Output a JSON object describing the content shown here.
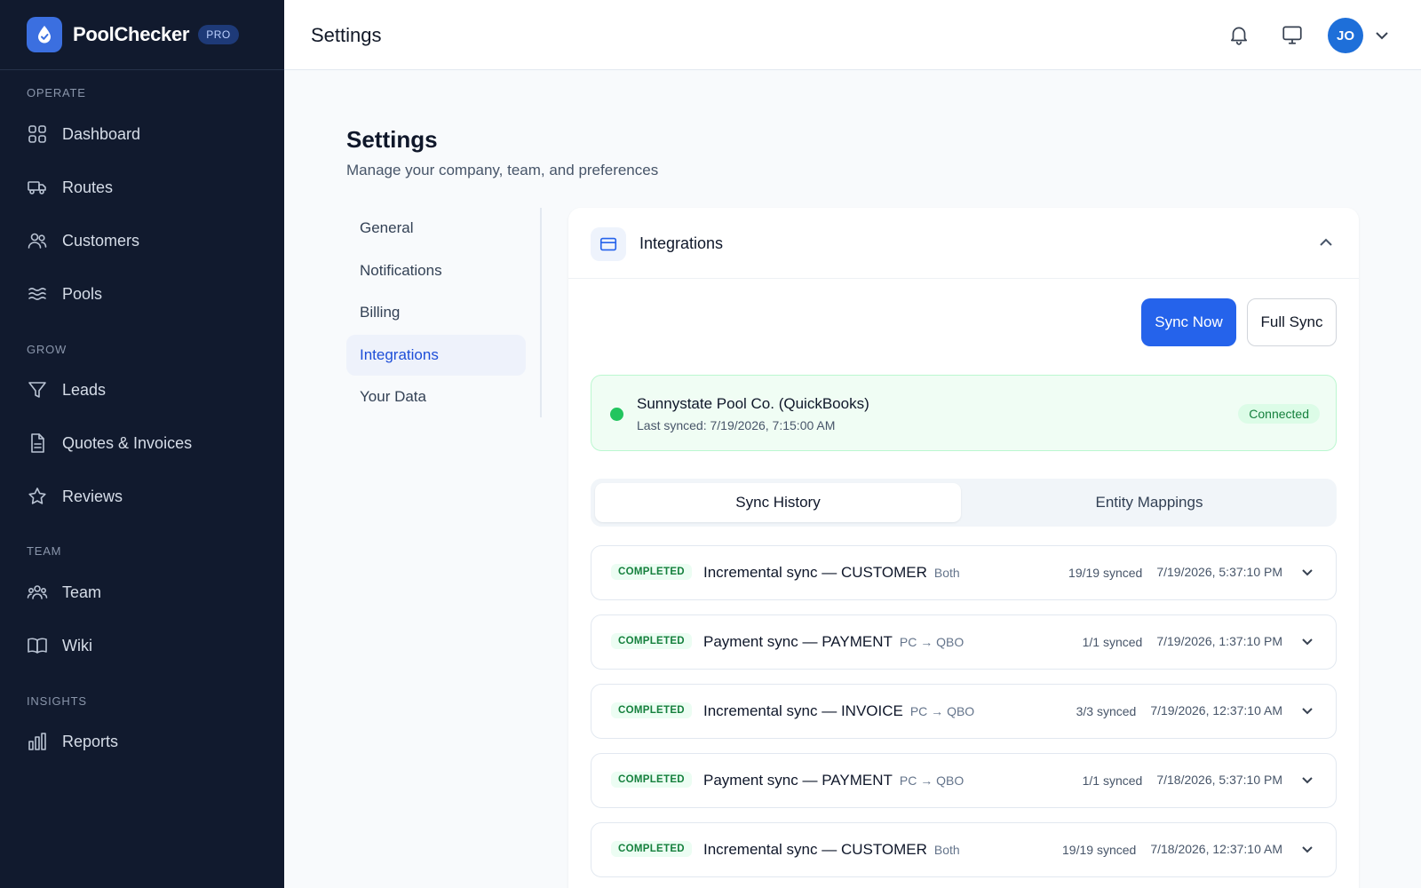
{
  "brand": {
    "name": "PoolChecker",
    "badge": "PRO"
  },
  "sidebar": {
    "sections": [
      {
        "title": "OPERATE",
        "items": [
          {
            "label": "Dashboard",
            "icon": "grid-icon"
          },
          {
            "label": "Routes",
            "icon": "truck-icon"
          },
          {
            "label": "Customers",
            "icon": "users-icon"
          },
          {
            "label": "Pools",
            "icon": "waves-icon"
          }
        ]
      },
      {
        "title": "GROW",
        "items": [
          {
            "label": "Leads",
            "icon": "funnel-icon"
          },
          {
            "label": "Quotes & Invoices",
            "icon": "document-icon"
          },
          {
            "label": "Reviews",
            "icon": "star-icon"
          }
        ]
      },
      {
        "title": "TEAM",
        "items": [
          {
            "label": "Team",
            "icon": "team-icon"
          },
          {
            "label": "Wiki",
            "icon": "book-icon"
          }
        ]
      },
      {
        "title": "INSIGHTS",
        "items": [
          {
            "label": "Reports",
            "icon": "bar-chart-icon"
          }
        ]
      }
    ]
  },
  "topbar": {
    "title": "Settings",
    "avatar_initials": "JO"
  },
  "page": {
    "title": "Settings",
    "subtitle": "Manage your company, team, and preferences"
  },
  "settings_nav": {
    "items": [
      "General",
      "Notifications",
      "Billing",
      "Integrations",
      "Your Data"
    ],
    "active": "Integrations"
  },
  "integrations": {
    "title": "Integrations",
    "sync_now_label": "Sync Now",
    "full_sync_label": "Full Sync",
    "connection": {
      "name": "Sunnystate Pool Co. (QuickBooks)",
      "last_synced": "Last synced: 7/19/2026, 7:15:00 AM",
      "status": "Connected"
    },
    "tabs": [
      "Sync History",
      "Entity Mappings"
    ],
    "active_tab": "Sync History",
    "history": [
      {
        "status": "COMPLETED",
        "title": "Incremental sync — CUSTOMER",
        "direction": "Both",
        "count": "19/19 synced",
        "time": "7/19/2026, 5:37:10 PM"
      },
      {
        "status": "COMPLETED",
        "title": "Payment sync — PAYMENT",
        "direction": "PC → QBO",
        "count": "1/1 synced",
        "time": "7/19/2026, 1:37:10 PM"
      },
      {
        "status": "COMPLETED",
        "title": "Incremental sync — INVOICE",
        "direction": "PC → QBO",
        "count": "3/3 synced",
        "time": "7/19/2026, 12:37:10 AM"
      },
      {
        "status": "COMPLETED",
        "title": "Payment sync — PAYMENT",
        "direction": "PC → QBO",
        "count": "1/1 synced",
        "time": "7/18/2026, 5:37:10 PM"
      },
      {
        "status": "COMPLETED",
        "title": "Incremental sync — CUSTOMER",
        "direction": "Both",
        "count": "19/19 synced",
        "time": "7/18/2026, 12:37:10 AM"
      }
    ]
  },
  "colors": {
    "sidebar_bg": "#111a2e",
    "accent": "#2563eb",
    "success": "#22c55e",
    "avatar": "#1e6fd9"
  }
}
